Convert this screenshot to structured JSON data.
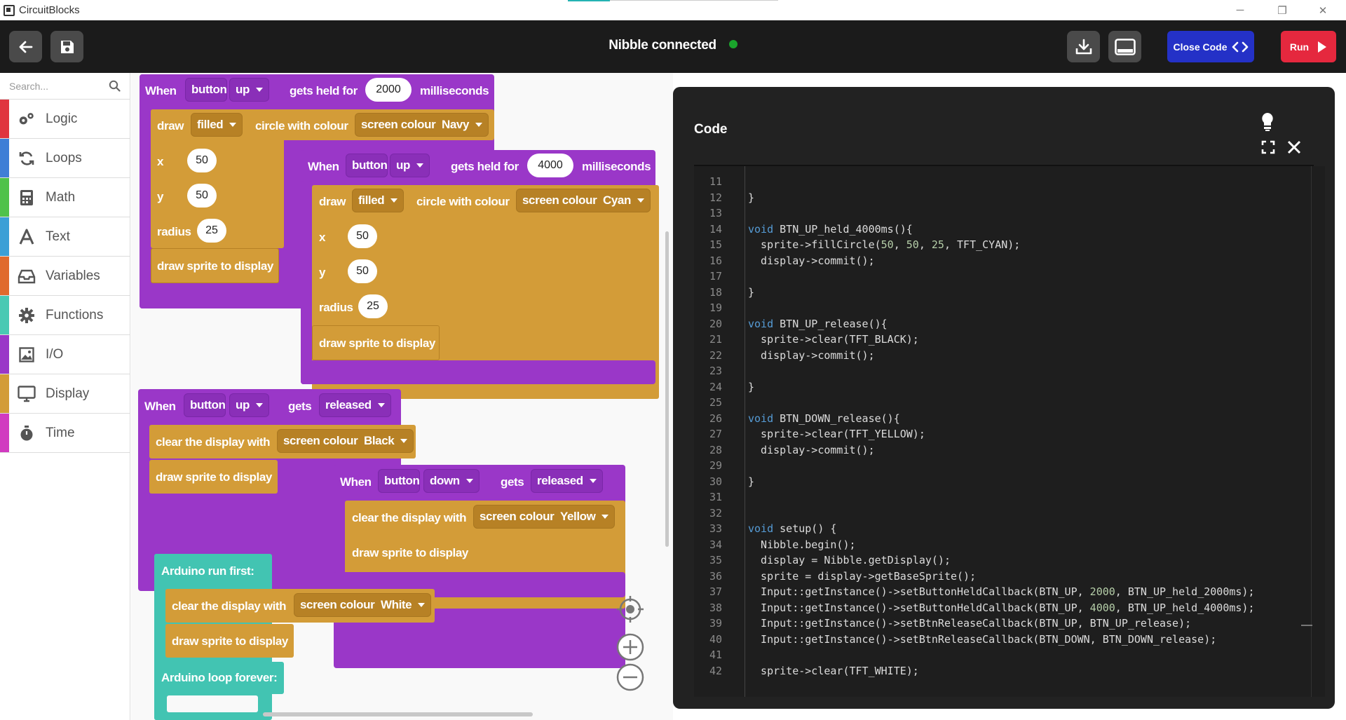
{
  "window": {
    "title": "CircuitBlocks",
    "controls": [
      "─",
      "❐",
      "✕"
    ]
  },
  "header": {
    "status": "Nibble connected",
    "status_color": "#1aa52c",
    "close_code_label": "Close Code",
    "run_label": "Run"
  },
  "sidebar": {
    "search_placeholder": "Search...",
    "categories": [
      {
        "label": "Logic",
        "color": "#e0353f",
        "icon": "gears-icon"
      },
      {
        "label": "Loops",
        "color": "#3f7ed6",
        "icon": "loop-icon"
      },
      {
        "label": "Math",
        "color": "#4fc24a",
        "icon": "calculator-icon"
      },
      {
        "label": "Text",
        "color": "#3b9fd6",
        "icon": "text-icon"
      },
      {
        "label": "Variables",
        "color": "#e06a2c",
        "icon": "inbox-icon"
      },
      {
        "label": "Functions",
        "color": "#49c9b3",
        "icon": "gear-icon"
      },
      {
        "label": "I/O",
        "color": "#9a37c8",
        "icon": "image-icon"
      },
      {
        "label": "Display",
        "color": "#d39c38",
        "icon": "monitor-icon"
      },
      {
        "label": "Time",
        "color": "#d13ac0",
        "icon": "stopwatch-icon"
      }
    ]
  },
  "blocks": {
    "when": "When",
    "button": "button",
    "gets_held_for": "gets held for",
    "milliseconds": "milliseconds",
    "gets": "gets",
    "released": "released",
    "draw": "draw",
    "filled": "filled",
    "circle_with_colour": "circle with colour",
    "screen_colour": "screen colour",
    "x": "x",
    "y": "y",
    "radius": "radius",
    "draw_sprite": "draw sprite to display",
    "clear_display": "clear the display with",
    "arduino_run_first": "Arduino run first:",
    "arduino_loop_forever": "Arduino loop forever:",
    "b1": {
      "button": "up",
      "ms": "2000",
      "colour": "Navy",
      "x": "50",
      "y": "50",
      "radius": "25"
    },
    "b2": {
      "button": "up",
      "ms": "4000",
      "colour": "Cyan",
      "x": "50",
      "y": "50",
      "radius": "25"
    },
    "b3": {
      "button": "up",
      "colour": "Black"
    },
    "b4": {
      "button": "down",
      "colour": "Yellow"
    },
    "b5": {
      "colour": "White"
    }
  },
  "code": {
    "title": "Code",
    "lines": [
      {
        "n": "11",
        "t": ""
      },
      {
        "n": "12",
        "t": "}"
      },
      {
        "n": "13",
        "t": ""
      },
      {
        "n": "14",
        "t": "void BTN_UP_held_4000ms(){"
      },
      {
        "n": "15",
        "t": "  sprite->fillCircle(50, 50, 25, TFT_CYAN);"
      },
      {
        "n": "16",
        "t": "  display->commit();"
      },
      {
        "n": "17",
        "t": ""
      },
      {
        "n": "18",
        "t": "}"
      },
      {
        "n": "19",
        "t": ""
      },
      {
        "n": "20",
        "t": "void BTN_UP_release(){"
      },
      {
        "n": "21",
        "t": "  sprite->clear(TFT_BLACK);"
      },
      {
        "n": "22",
        "t": "  display->commit();"
      },
      {
        "n": "23",
        "t": ""
      },
      {
        "n": "24",
        "t": "}"
      },
      {
        "n": "25",
        "t": ""
      },
      {
        "n": "26",
        "t": "void BTN_DOWN_release(){"
      },
      {
        "n": "27",
        "t": "  sprite->clear(TFT_YELLOW);"
      },
      {
        "n": "28",
        "t": "  display->commit();"
      },
      {
        "n": "29",
        "t": ""
      },
      {
        "n": "30",
        "t": "}"
      },
      {
        "n": "31",
        "t": ""
      },
      {
        "n": "32",
        "t": ""
      },
      {
        "n": "33",
        "t": "void setup() {"
      },
      {
        "n": "34",
        "t": "  Nibble.begin();"
      },
      {
        "n": "35",
        "t": "  display = Nibble.getDisplay();"
      },
      {
        "n": "36",
        "t": "  sprite = display->getBaseSprite();"
      },
      {
        "n": "37",
        "t": "  Input::getInstance()->setButtonHeldCallback(BTN_UP, 2000, BTN_UP_held_2000ms);"
      },
      {
        "n": "38",
        "t": "  Input::getInstance()->setButtonHeldCallback(BTN_UP, 4000, BTN_UP_held_4000ms);"
      },
      {
        "n": "39",
        "t": "  Input::getInstance()->setBtnReleaseCallback(BTN_UP, BTN_UP_release);"
      },
      {
        "n": "40",
        "t": "  Input::getInstance()->setBtnReleaseCallback(BTN_DOWN, BTN_DOWN_release);"
      },
      {
        "n": "41",
        "t": ""
      },
      {
        "n": "42",
        "t": "  sprite->clear(TFT_WHITE);"
      }
    ]
  }
}
